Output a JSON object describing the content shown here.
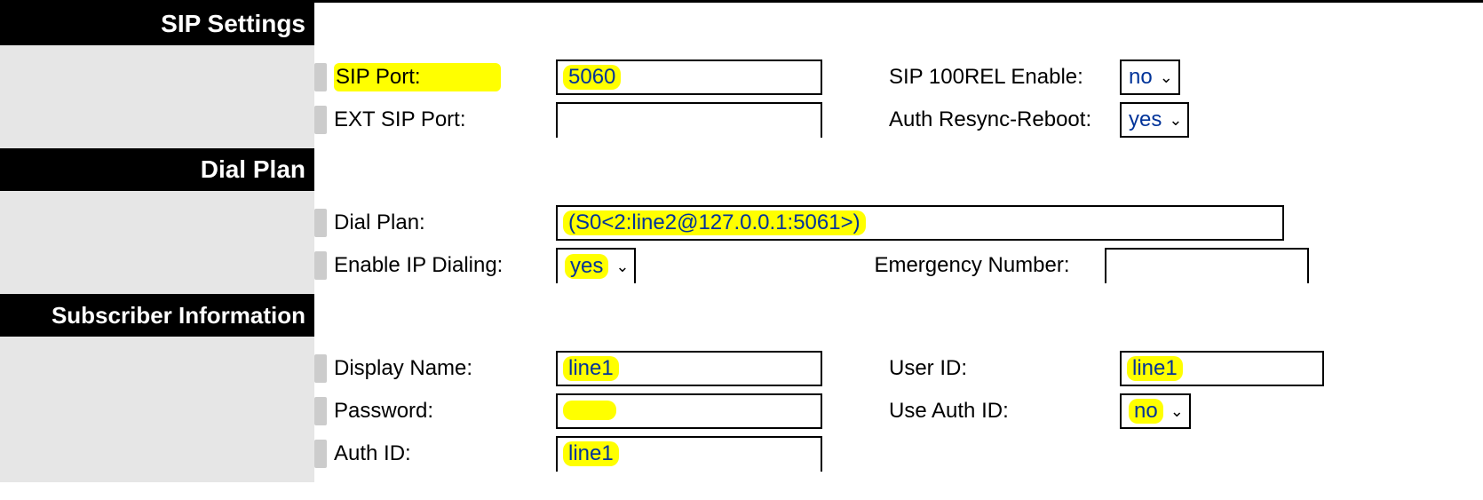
{
  "sections": {
    "sip_settings": "SIP Settings",
    "dial_plan": "Dial Plan",
    "subscriber_info": "Subscriber Information"
  },
  "sip": {
    "sip_port_label": "SIP Port:",
    "sip_port_value": "5060",
    "ext_sip_port_label": "EXT SIP Port:",
    "ext_sip_port_value": "",
    "sip_100rel_label": "SIP 100REL Enable:",
    "sip_100rel_value": "no",
    "auth_resync_label": "Auth Resync-Reboot:",
    "auth_resync_value": "yes"
  },
  "dial": {
    "dial_plan_label": "Dial Plan:",
    "dial_plan_value": "(S0<2:line2@127.0.0.1:5061>)",
    "enable_ip_dialing_label": "Enable IP Dialing:",
    "enable_ip_dialing_value": "yes",
    "emergency_number_label": "Emergency Number:",
    "emergency_number_value": ""
  },
  "subscriber": {
    "display_name_label": "Display Name:",
    "display_name_value": "line1",
    "user_id_label": "User ID:",
    "user_id_value": "line1",
    "password_label": "Password:",
    "password_value": "••••",
    "use_auth_id_label": "Use Auth ID:",
    "use_auth_id_value": "no",
    "auth_id_label": "Auth ID:",
    "auth_id_value": "line1"
  },
  "highlight_color": "#ffff00"
}
